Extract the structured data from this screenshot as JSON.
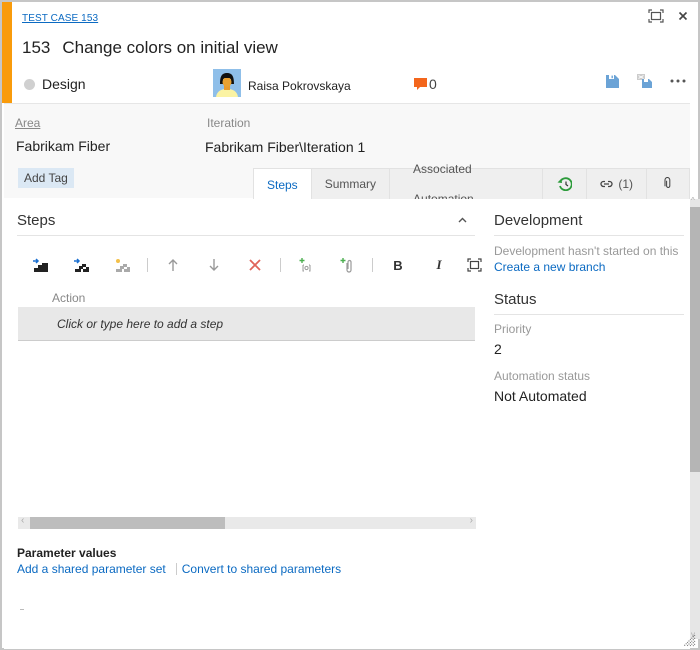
{
  "work_item": {
    "type_link": "TEST CASE 153",
    "id": "153",
    "title": "Change colors on initial view",
    "state": "Design",
    "assignee": "Raisa Pokrovskaya",
    "discussion_count": "0",
    "accent_color": "#f99b0b"
  },
  "window_controls": {
    "maximize_icon": "maximize-icon",
    "close_icon": "close-icon"
  },
  "header_tools": {
    "save_icon": "save-icon",
    "save_and_close_icon": "save-and-close-icon",
    "more_icon": "more-actions-icon"
  },
  "fields": {
    "area_label": "Area",
    "area_value": "Fabrikam Fiber",
    "iteration_label": "Iteration",
    "iteration_value": "Fabrikam Fiber\\Iteration 1",
    "add_tag_label": "Add Tag"
  },
  "tabs": [
    {
      "label": "Steps",
      "active": true
    },
    {
      "label": "Summary",
      "active": false
    },
    {
      "label": "Associated Automation",
      "active": false
    },
    {
      "label": "",
      "icon": "history-icon",
      "active": false
    },
    {
      "label": "(1)",
      "icon": "link-icon",
      "active": false
    },
    {
      "label": "",
      "icon": "attachment-icon",
      "active": false
    }
  ],
  "steps": {
    "title": "Steps",
    "toolbar": [
      "insert-step-icon",
      "insert-shared-steps-icon",
      "create-shared-steps-icon",
      "move-up-icon",
      "move-down-icon",
      "delete-step-icon",
      "add-attachment-icon",
      "attach-file-icon",
      "bold-icon",
      "italic-icon",
      "fullscreen-icon"
    ],
    "column_action": "Action",
    "add_step_placeholder": "Click or type here to add a step",
    "hscroll_position": 0.45
  },
  "parameters": {
    "title": "Parameter values",
    "add_shared_link": "Add a shared parameter set",
    "convert_link": "Convert to shared parameters"
  },
  "development": {
    "title": "Development",
    "message": "Development hasn't started on this",
    "create_branch_link": "Create a new branch"
  },
  "status": {
    "title": "Status",
    "priority_label": "Priority",
    "priority_value": "2",
    "automation_label": "Automation status",
    "automation_value": "Not Automated"
  },
  "colors": {
    "link": "#0b6ac2",
    "discussion": "#f3661c",
    "save": "#6ba3d6"
  }
}
